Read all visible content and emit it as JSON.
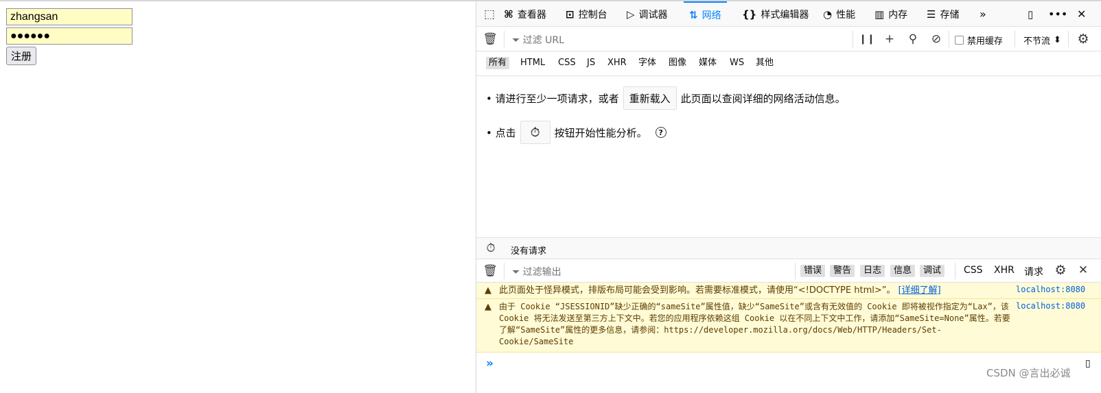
{
  "webpage": {
    "username_value": "zhangsan",
    "password_value": "●●●●●●",
    "register_label": "注册"
  },
  "devtools": {
    "tabs": [
      {
        "icon": "inspector-icon",
        "glyph": "⌘",
        "label": "查看器"
      },
      {
        "icon": "console-icon",
        "glyph": "⊡",
        "label": "控制台"
      },
      {
        "icon": "debugger-icon",
        "glyph": "▷",
        "label": "调试器"
      },
      {
        "icon": "network-icon",
        "glyph": "⇅",
        "label": "网络"
      },
      {
        "icon": "style-editor-icon",
        "glyph": "{}",
        "label": "样式编辑器"
      },
      {
        "icon": "performance-icon",
        "glyph": "◔",
        "label": "性能"
      },
      {
        "icon": "memory-icon",
        "glyph": "▥",
        "label": "内存"
      },
      {
        "icon": "storage-icon",
        "glyph": "☰",
        "label": "存储"
      }
    ],
    "active_tab": "网络",
    "net_toolbar": {
      "filter_placeholder": "过滤 URL",
      "disable_cache_label": "禁用缓存",
      "throttle_label": "不节流"
    },
    "types": [
      "所有",
      "HTML",
      "CSS",
      "JS",
      "XHR",
      "字体",
      "图像",
      "媒体",
      "WS",
      "其他"
    ],
    "selected_type": "所有",
    "empty": {
      "line1_before": "• 请进行至少一项请求，或者",
      "reload_label": "重新载入",
      "line1_after": "此页面以查阅详细的网络活动信息。",
      "line2_before": "• 点击",
      "line2_after": "按钮开始性能分析。",
      "help_glyph": "?"
    },
    "status": {
      "text": "没有请求"
    },
    "console_toolbar": {
      "filter_placeholder": "过滤输出",
      "levels": [
        "错误",
        "警告",
        "日志",
        "信息",
        "调试"
      ],
      "types": [
        "CSS",
        "XHR",
        "请求"
      ]
    },
    "messages": [
      {
        "text": "此页面处于怪异模式，排版布局可能会受到影响。若需要标准模式，请使用“<!DOCTYPE html>”。",
        "link": "[详细了解]",
        "source": "localhost:8080"
      },
      {
        "text": "由于 Cookie “JSESSIONID”缺少正确的“sameSite”属性值，缺少“SameSite”或含有无效值的 Cookie 即将被视作指定为“Lax”，该 Cookie 将无法发送至第三方上下文中。若您的应用程序依赖这组 Cookie 以在不同上下文中工作，请添加“SameSite=None”属性。若要了解“SameSite”属性的更多信息，请参阅：https://developer.mozilla.org/docs/Web/HTTP/Headers/Set-Cookie/SameSite",
        "source": "localhost:8080"
      }
    ],
    "watermark": "CSDN @言出必诚"
  }
}
